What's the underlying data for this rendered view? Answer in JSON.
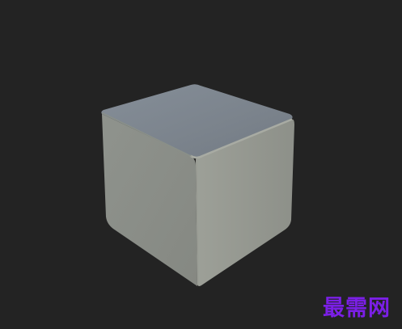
{
  "viewport": {
    "background_color": "#232323",
    "object": "cube"
  },
  "colors": {
    "top_face": "#7d858e",
    "left_face": "#8c9089",
    "right_face": "#959890"
  },
  "watermark": {
    "text": "最需网",
    "color": "#7b1fe6"
  }
}
